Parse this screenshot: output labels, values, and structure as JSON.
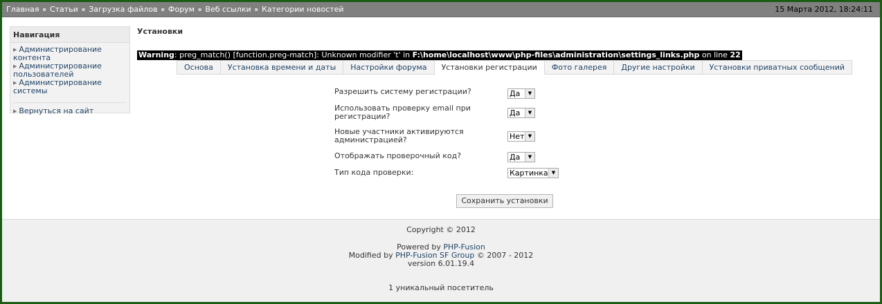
{
  "topnav": {
    "items": [
      "Главная",
      "Статьи",
      "Загрузка файлов",
      "Форум",
      "Веб ссылки",
      "Категории новостей"
    ],
    "separator": "▪",
    "datetime": "15 Марта 2012, 18:24:11"
  },
  "sidebar": {
    "title": "Навигация",
    "items": [
      {
        "line1": "Администрирование",
        "line2": "контента"
      },
      {
        "line1": "Администрирование",
        "line2": "пользователей"
      },
      {
        "line1": "Администрирование",
        "line2": "системы"
      }
    ],
    "back": "Вернуться на сайт"
  },
  "page": {
    "title": "Установки"
  },
  "warning": {
    "label": "Warning",
    "message": ": preg_match() [function.preg-match]: Unknown modifier 't' in ",
    "file": "F:\\home\\localhost\\www\\php-files\\administration\\settings_links.php",
    "online": " on line ",
    "line": "22"
  },
  "tabs": [
    {
      "label": "Основа",
      "active": false
    },
    {
      "label": "Установка времени и даты",
      "active": false
    },
    {
      "label": "Настройки форума",
      "active": false
    },
    {
      "label": "Установки регистрации",
      "active": true
    },
    {
      "label": "Фото галерея",
      "active": false
    },
    {
      "label": "Другие настройки",
      "active": false
    },
    {
      "label": "Установки приватных сообщений",
      "active": false
    }
  ],
  "form": {
    "rows": [
      {
        "label": "Разрешить систему регистрации?",
        "value": "Да"
      },
      {
        "label": "Использовать проверку email при регистрации?",
        "value": "Да"
      },
      {
        "label": "Новые участники активируются администрацией?",
        "value": "Нет"
      },
      {
        "label": "Отображать проверочный код?",
        "value": "Да"
      },
      {
        "label": "Тип кода проверки:",
        "value": "Картинка"
      }
    ],
    "save_label": "Сохранить установки"
  },
  "footer": {
    "copyright": "Copyright © 2012",
    "powered_prefix": "Powered by ",
    "powered_link": "PHP-Fusion",
    "modified_prefix": "Modified by ",
    "modified_link": "PHP-Fusion SF Group",
    "modified_suffix": " © 2007 - 2012",
    "version": "version 6.01.19.4",
    "visitors": "1 уникальный посетитель"
  },
  "colors": {
    "border_green": "#1a5c14",
    "topbar": "#808080",
    "link": "#224466"
  }
}
